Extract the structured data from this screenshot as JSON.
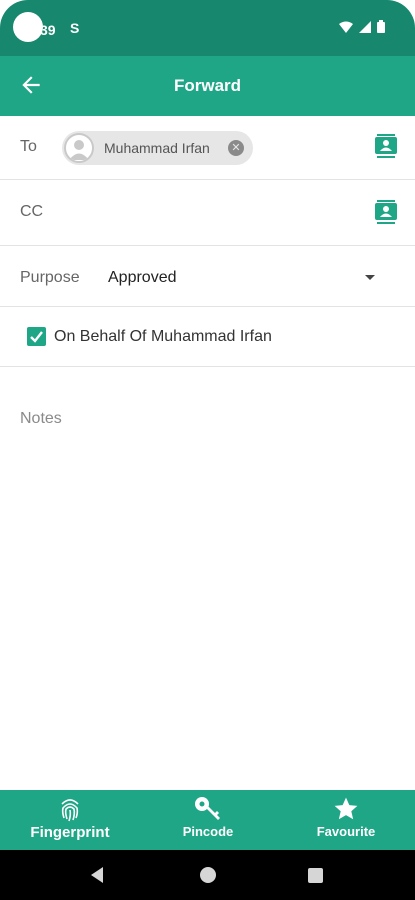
{
  "status_bar": {
    "time": "39",
    "notification_icon": "S"
  },
  "app_bar": {
    "title": "Forward",
    "back_icon": "arrow-left-icon"
  },
  "form": {
    "to": {
      "label": "To",
      "recipients": [
        {
          "name": "Muhammad Irfan"
        }
      ],
      "contact_icon": "contact-book-icon"
    },
    "cc": {
      "label": "CC",
      "contact_icon": "contact-book-icon"
    },
    "purpose": {
      "label": "Purpose",
      "value": "Approved"
    },
    "on_behalf": {
      "checked": true,
      "label": "On Behalf Of Muhammad Irfan"
    },
    "notes": {
      "placeholder": "Notes"
    }
  },
  "bottom_nav": {
    "items": [
      {
        "label": "Fingerprint",
        "icon": "fingerprint-icon"
      },
      {
        "label": "Pincode",
        "icon": "key-icon"
      },
      {
        "label": "Favourite",
        "icon": "star-icon"
      }
    ]
  },
  "colors": {
    "status_bar": "#17876e",
    "primary": "#1fa686",
    "system_nav": "#000000"
  }
}
